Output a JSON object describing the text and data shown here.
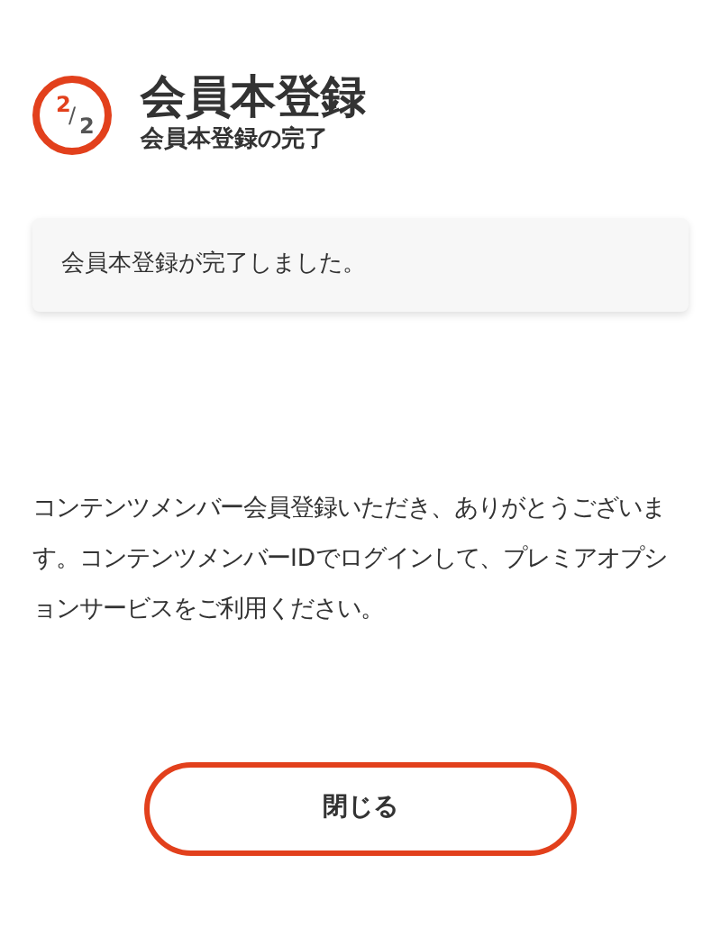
{
  "step": {
    "current": "2",
    "separator": "/",
    "total": "2"
  },
  "title": "会員本登録",
  "subtitle": "会員本登録の完了",
  "message": "会員本登録が完了しました。",
  "body": "コンテンツメンバー会員登録いただき、ありがとうございます。コンテンツメンバーIDでログインして、プレミアオプションサービスをご利用ください。",
  "buttons": [
    "閉じる"
  ]
}
